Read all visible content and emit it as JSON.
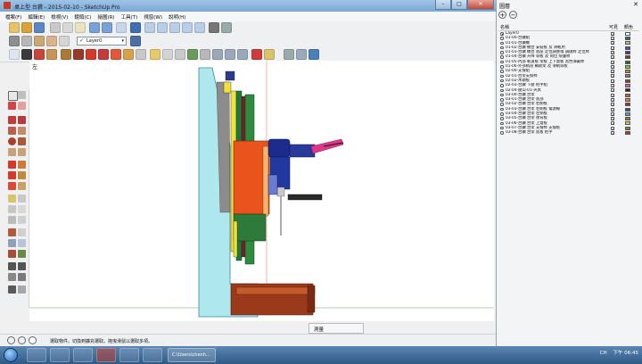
{
  "window": {
    "title": "桌上型 台鑽 - 2015-02-10 - SketchUp Pro",
    "controls": {
      "minimize": "–",
      "maximize": "□",
      "close": "✕"
    }
  },
  "menu": [
    "檔案(F)",
    "編輯(E)",
    "檢視(V)",
    "鏡頭(C)",
    "繪圖(R)",
    "工具(T)",
    "視窗(W)",
    "說明(H)"
  ],
  "layer_selector": {
    "value": "Layer0",
    "check": "✓",
    "arrow": "▾"
  },
  "viewport": {
    "label": "左"
  },
  "status": {
    "message": "選取物件。切換到擴充選取。拖曳滑鼠以選取多項。",
    "measurement_label": "測量"
  },
  "layers_panel": {
    "title": "圖層",
    "close": "✕",
    "tools": [
      "+",
      "−"
    ],
    "headers": {
      "name": "名稱",
      "visible": "可見",
      "color": "顏色"
    },
    "layers": [
      {
        "name": "Layer0",
        "active": true,
        "color": "#ffffff"
      },
      {
        "name": "01-00-台鑽組",
        "active": false,
        "color": "#1c6f6f"
      },
      {
        "name": "01-01-台鑽機",
        "active": false,
        "color": "#c9b98a"
      },
      {
        "name": "01-02-台鑽 機台 安裝板 及 滑軌用",
        "active": false,
        "color": "#3a5f96"
      },
      {
        "name": "01-03-台鑽 機台 底座 定位調整塊 調鏈桿 定位桿",
        "active": false,
        "color": "#6b2f5e"
      },
      {
        "name": "01-04-台鑽 升降 導板 及 筒位 限量桿",
        "active": false,
        "color": "#7a3b1f"
      },
      {
        "name": "01-05-內部 軌道板 架板 上下蓋板 黑色彈簧桿",
        "active": false,
        "color": "#2e6a3a"
      },
      {
        "name": "01-06-外部軌道 輔助架 及 滑軌導板",
        "active": false,
        "color": "#8fbf3a"
      },
      {
        "name": "02-00-支撐組",
        "active": false,
        "color": "#b58a2f"
      },
      {
        "name": "02-01-台架支撐桿",
        "active": false,
        "color": "#7f7f7f"
      },
      {
        "name": "02-02-木頭板",
        "active": false,
        "color": "#a43c2a"
      },
      {
        "name": "02-03-台鑽 下壓 把手組",
        "active": false,
        "color": "#d65a8a"
      },
      {
        "name": "02-04-壓山-01-夾具",
        "active": false,
        "color": "#2a2a2a"
      },
      {
        "name": "03-00-台鑽 台架",
        "active": false,
        "color": "#c35f2c"
      },
      {
        "name": "03-01-台鑽 台架 底部",
        "active": false,
        "color": "#e07b39"
      },
      {
        "name": "03-02-台鑽 台架 右側板",
        "active": false,
        "color": "#9c2b2b"
      },
      {
        "name": "03-03-台鑽 台架 右側板 電源線",
        "active": false,
        "color": "#4a4a8a"
      },
      {
        "name": "03-04-台鑽 台架 左側板",
        "active": false,
        "color": "#5aa0c8"
      },
      {
        "name": "03-05-台鑽 台架 後背板",
        "active": false,
        "color": "#a06a3b"
      },
      {
        "name": "03-06-台鑽 台架 上蓋板",
        "active": false,
        "color": "#d9c46b"
      },
      {
        "name": "03-07-台鑽 台架 支撐桿 支撐板",
        "active": false,
        "color": "#6a8a4a"
      },
      {
        "name": "03-08-台鑽 台架 底板 把手",
        "active": false,
        "color": "#b03a3a"
      }
    ]
  },
  "taskbar": {
    "folder_label": "C:\\Users\\chenh...",
    "language": "CH",
    "time": "下午 06:45"
  },
  "colors": {
    "base_plate": "#aee8ee",
    "column_plate": "#1e7a3c",
    "red_block": "#e8541c",
    "drill_body": "#1d2c8c",
    "handle_pink": "#e0368a",
    "wood_base": "#9b3a1a"
  }
}
